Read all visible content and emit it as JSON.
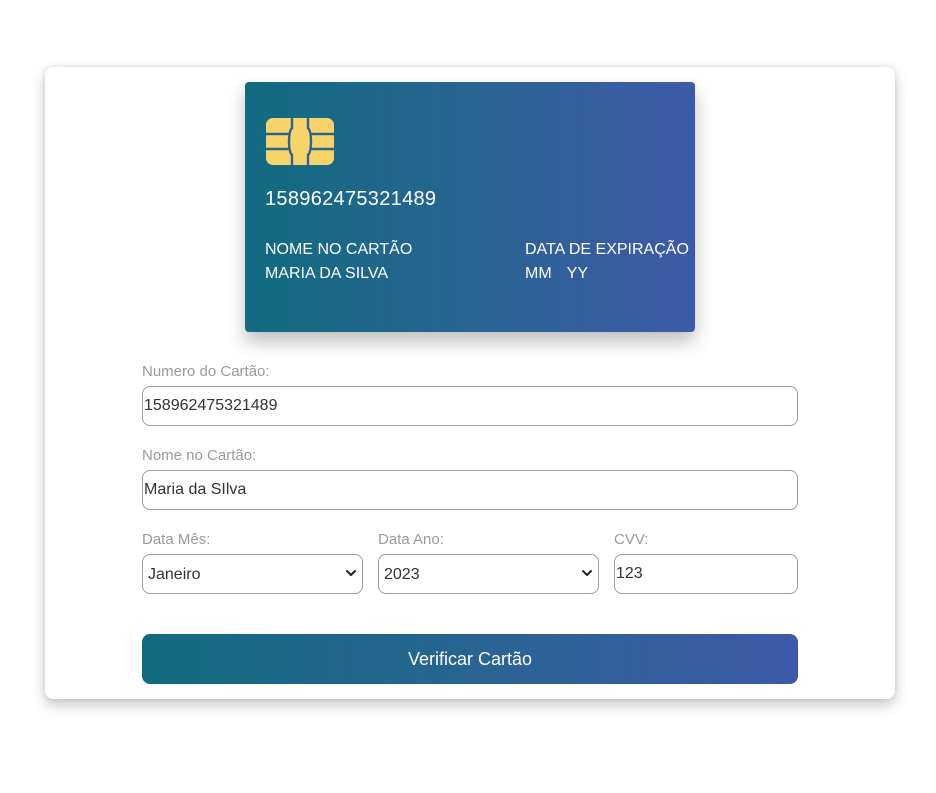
{
  "card": {
    "number": "158962475321489",
    "name_title": "NOME NO CARTÃO",
    "name_value": "MARIA DA SILVA",
    "expiry_title": "DATA DE EXPIRAÇÃO",
    "expiry_month": "MM",
    "expiry_year": "YY",
    "chip_icon": "chip-icon",
    "gradient_start": "#116b80",
    "gradient_end": "#3c5aa8",
    "chip_color": "#f7d46a"
  },
  "form": {
    "number_label": "Numero do Cartão:",
    "number_value": "158962475321489",
    "name_label": "Nome no Cartão:",
    "name_value": "Maria da SIlva",
    "month_label": "Data Mês:",
    "month_selected": "Janeiro",
    "year_label": "Data Ano:",
    "year_selected": "2023",
    "cvv_label": "CVV:",
    "cvv_value": "123",
    "submit_label": "Verificar Cartão",
    "chevron_icon": "chevron-down-icon"
  }
}
